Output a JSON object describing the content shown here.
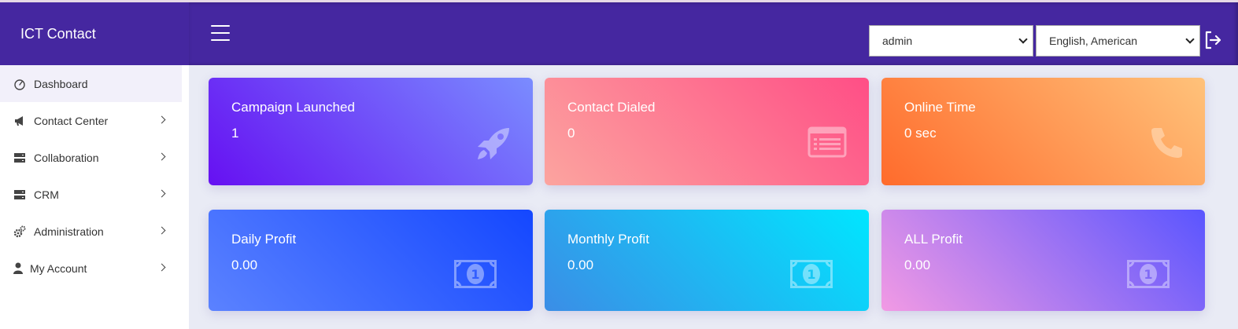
{
  "app": {
    "title": "ICT Contact"
  },
  "header": {
    "user_select": {
      "selected": "admin"
    },
    "language_select": {
      "selected": "English, American"
    }
  },
  "sidebar": {
    "items": [
      {
        "label": "Dashboard",
        "icon": "gauge-icon",
        "active": true
      },
      {
        "label": "Contact Center",
        "icon": "megaphone-icon"
      },
      {
        "label": "Collaboration",
        "icon": "server-icon"
      },
      {
        "label": "CRM",
        "icon": "server-icon"
      },
      {
        "label": "Administration",
        "icon": "cogs-icon"
      },
      {
        "label": "My Account",
        "icon": "user-icon"
      }
    ]
  },
  "cards": [
    {
      "title": "Campaign Launched",
      "value": "1",
      "icon": "rocket-icon"
    },
    {
      "title": "Contact Dialed",
      "value": "0",
      "icon": "list-card-icon"
    },
    {
      "title": "Online Time",
      "value": "0 sec",
      "icon": "phone-icon"
    },
    {
      "title": "Daily Profit",
      "value": "0.00",
      "icon": "money-bill-icon"
    },
    {
      "title": "Monthly Profit",
      "value": "0.00",
      "icon": "money-bill-icon"
    },
    {
      "title": "ALL Profit",
      "value": "0.00",
      "icon": "money-bill-icon"
    }
  ],
  "colors": {
    "primary": "#4527a0",
    "background": "#e9ebf5"
  }
}
